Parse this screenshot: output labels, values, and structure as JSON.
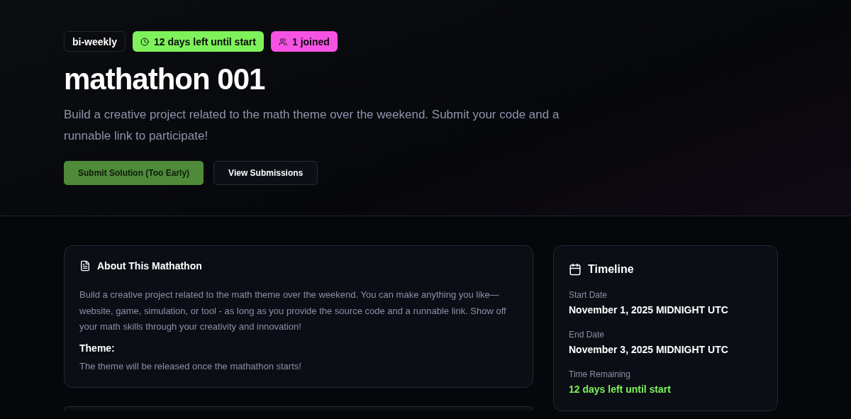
{
  "badges": [
    {
      "kind": "plain",
      "label": "bi-weekly"
    },
    {
      "kind": "clock",
      "label": "12 days left until start",
      "color": "#7ef25a"
    },
    {
      "kind": "people",
      "label": "1 joined",
      "color": "#f653e4"
    }
  ],
  "title": "mathathon 001",
  "subtitle": "Build a creative project related to the math theme over the weekend. Submit your code and a runnable link to participate!",
  "buttons": [
    {
      "label": "Submit Solution (Too Early)",
      "kind": "primary",
      "disabled": true
    },
    {
      "label": "View Submissions",
      "kind": "outline",
      "disabled": false
    }
  ],
  "about": {
    "title": "About This Mathathon",
    "text": "Build a creative project related to the math theme over the weekend. You can make anything you like—website, game, simulation, or tool - as long as you provide the source code and a runnable link. Show off your math skills through your creativity and innovation!",
    "theme_label": "Theme:",
    "theme_text": "The theme will be released once the mathathon starts!"
  },
  "timeline": {
    "title": "Timeline",
    "items": [
      {
        "label": "Start Date",
        "value": "November 1, 2025 MIDNIGHT UTC",
        "kind": "plain"
      },
      {
        "label": "End Date",
        "value": "November 3, 2025 MIDNIGHT UTC",
        "kind": "plain"
      },
      {
        "label": "Time Remaining",
        "value": "12 days left until start",
        "kind": "highlight"
      }
    ]
  }
}
